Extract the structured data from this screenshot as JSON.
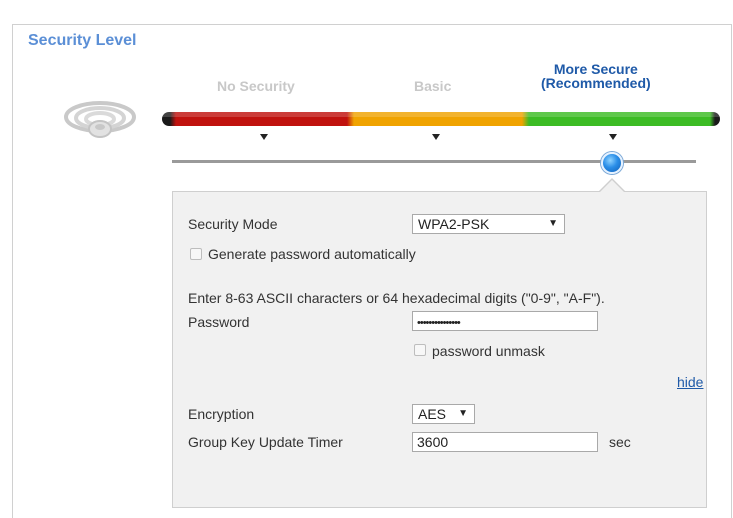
{
  "section": {
    "title": "Security Level"
  },
  "levels": [
    {
      "label": "No Security",
      "active": false
    },
    {
      "label": "Basic",
      "active": false
    },
    {
      "label": "More Secure\n(Recommended)",
      "active": true,
      "line1": "More Secure",
      "line2": "(Recommended)"
    }
  ],
  "slider": {
    "selected_level": "More Secure (Recommended)"
  },
  "form": {
    "security_mode": {
      "label": "Security Mode",
      "value": "WPA2-PSK",
      "caret": "▼"
    },
    "generate_password": {
      "label": "Generate password automatically",
      "checked": false
    },
    "hint": "Enter 8-63 ASCII characters or 64 hexadecimal digits (\"0-9\", \"A-F\").",
    "password": {
      "label": "Password",
      "value": "•••••••••••••••"
    },
    "password_unmask": {
      "label": "password unmask",
      "checked": false
    },
    "hide_link": "hide",
    "encryption": {
      "label": "Encryption",
      "value": "AES",
      "caret": "▼"
    },
    "group_key_timer": {
      "label": "Group Key Update Timer",
      "value": "3600",
      "unit": "sec"
    }
  },
  "colors": {
    "title": "#5b8fd6",
    "active_level": "#1f5aa8",
    "inactive_level": "#c8c8c8",
    "bar_red": "#c0120e",
    "bar_orange": "#f0a300",
    "bar_green": "#3cbc24"
  }
}
